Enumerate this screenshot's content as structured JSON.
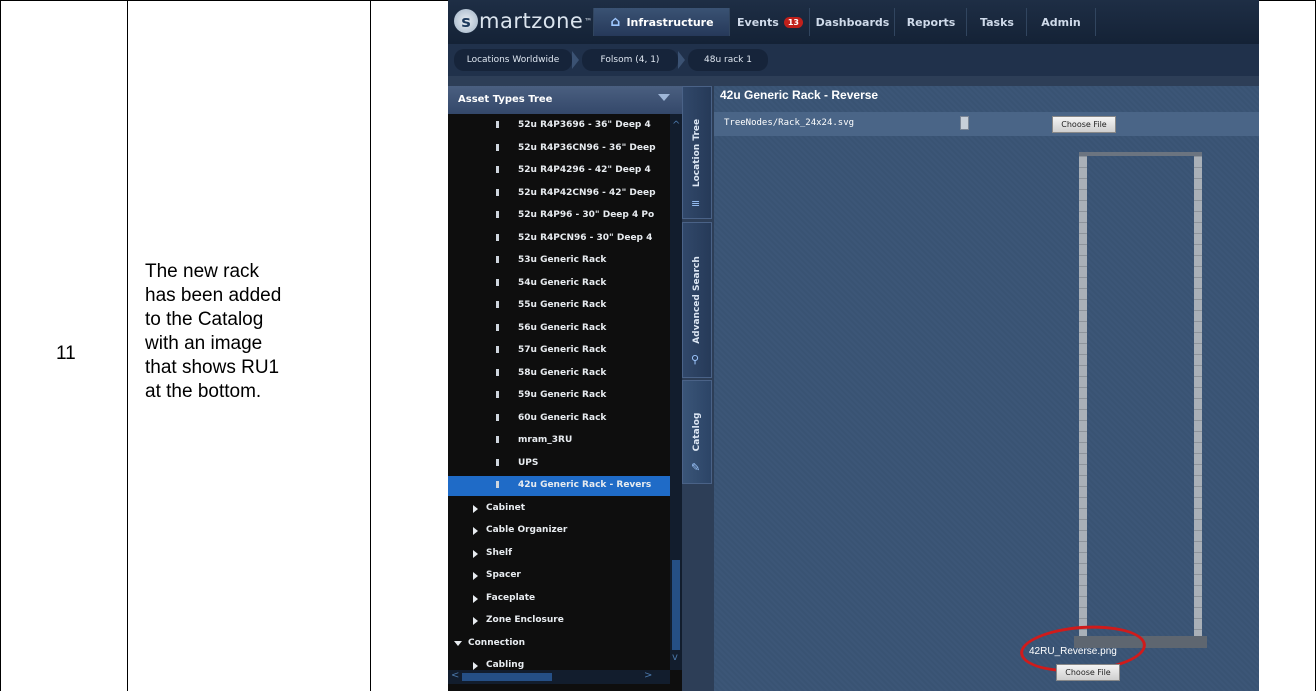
{
  "step": {
    "number": "11",
    "description": "The new rack\nhas been added\nto the Catalog\nwith an image\nthat shows RU1\nat the bottom."
  },
  "app": {
    "logo_text": "martzone",
    "logo_letter": "s",
    "logo_tm": "™",
    "nav": [
      {
        "label": "Infrastructure",
        "active": true
      },
      {
        "label": "Events",
        "badge": "13"
      },
      {
        "label": "Dashboards"
      },
      {
        "label": "Reports"
      },
      {
        "label": "Tasks"
      },
      {
        "label": "Admin"
      }
    ],
    "breadcrumb": [
      "Locations Worldwide",
      "Folsom (4, 1)",
      "48u rack 1"
    ]
  },
  "tree": {
    "header": "Asset Types Tree",
    "items": [
      {
        "label": "52u R4P3696 - 36\" Deep 4",
        "level": 2
      },
      {
        "label": "52u R4P36CN96 - 36\" Deep",
        "level": 2
      },
      {
        "label": "52u R4P4296 - 42\" Deep 4",
        "level": 2
      },
      {
        "label": "52u R4P42CN96 - 42\" Deep",
        "level": 2
      },
      {
        "label": "52u R4P96 - 30\" Deep 4 Po",
        "level": 2
      },
      {
        "label": "52u R4PCN96 - 30\" Deep 4",
        "level": 2
      },
      {
        "label": "53u Generic Rack",
        "level": 2
      },
      {
        "label": "54u Generic Rack",
        "level": 2
      },
      {
        "label": "55u Generic Rack",
        "level": 2
      },
      {
        "label": "56u Generic Rack",
        "level": 2
      },
      {
        "label": "57u Generic Rack",
        "level": 2
      },
      {
        "label": "58u Generic Rack",
        "level": 2
      },
      {
        "label": "59u Generic Rack",
        "level": 2
      },
      {
        "label": "60u Generic Rack",
        "level": 2
      },
      {
        "label": "mram_3RU",
        "level": 2
      },
      {
        "label": "UPS",
        "level": 2
      },
      {
        "label": "42u Generic Rack - Revers",
        "level": 2,
        "selected": true
      },
      {
        "label": "Cabinet",
        "level": 1
      },
      {
        "label": "Cable Organizer",
        "level": 1
      },
      {
        "label": "Shelf",
        "level": 1
      },
      {
        "label": "Spacer",
        "level": 1
      },
      {
        "label": "Faceplate",
        "level": 1
      },
      {
        "label": "Zone Enclosure",
        "level": 1
      },
      {
        "label": "Connection",
        "level": 0
      },
      {
        "label": "Cabling",
        "level": 1
      }
    ]
  },
  "side_tabs": [
    "Location Tree",
    "Advanced Search",
    "Catalog"
  ],
  "main": {
    "title": "42u Generic Rack - Reverse",
    "svg_path": "TreeNodes/Rack_24x24.svg",
    "choose_file_label": "Choose File",
    "image_name": "42RU_Reverse.png"
  },
  "colors": {
    "selected_row": "#1f6bc7",
    "highlight_ellipse": "#d01b1b",
    "event_badge": "#c0201b"
  }
}
